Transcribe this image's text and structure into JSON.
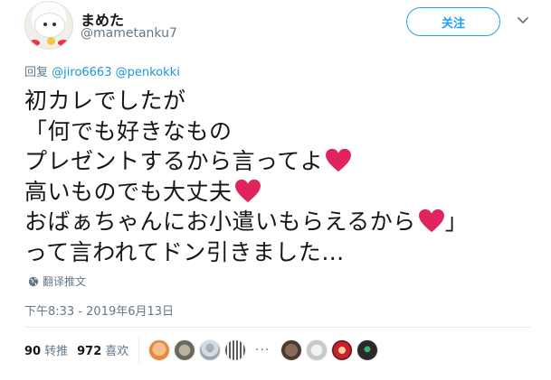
{
  "tweet": {
    "display_name": "まめた",
    "handle": "@mametanku7",
    "follow_label": "关注",
    "reply_prefix": "回复",
    "reply_mentions": [
      "@jiro6663",
      "@penkokki"
    ],
    "lines": [
      "初カレでしたが",
      "「何でも好きなもの",
      "プレゼントするから言ってよ",
      "高いものでも大丈夫",
      "おばぁちゃんにお小遣いもらえるから",
      "って言われてドン引きました…"
    ],
    "line_end_after_heart": "」",
    "translate_label": "翻译推文",
    "timestamp": "下午8:33 - 2019年6月13日",
    "retweet_count": "90",
    "retweet_label": "转推",
    "like_count": "972",
    "like_label": "喜欢"
  },
  "icons": {
    "heart": "red-heart-emoji",
    "globe": "globe-icon",
    "chevron": "chevron-down-icon"
  },
  "colors": {
    "accent": "#1da1f2",
    "heart": "#e0245e",
    "muted": "#657786"
  },
  "liker_avatars": [
    "orange-face",
    "cat",
    "person-silhouette",
    "qr-pattern",
    "brown-cat",
    "grey-cartoon",
    "red-character",
    "dark-character"
  ]
}
